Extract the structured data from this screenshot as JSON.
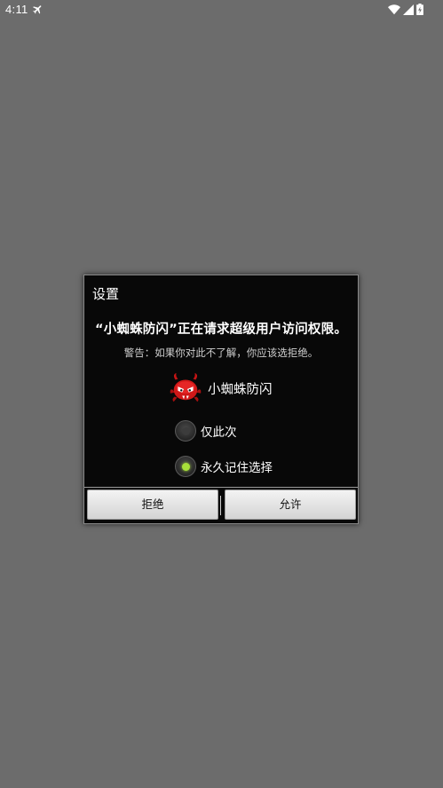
{
  "status_bar": {
    "time": "4:11",
    "icons": [
      "airplane-icon",
      "wifi-icon",
      "signal-icon",
      "battery-icon"
    ]
  },
  "dialog": {
    "title": "设置",
    "heading": "“小蜘蛛防闪”正在请求超级用户访问权限。",
    "warning": "警告：如果你对此不了解，你应该选拒绝。",
    "app_name": "小蜘蛛防闪",
    "options": [
      {
        "label": "仅此次",
        "checked": false
      },
      {
        "label": "永久记住选择",
        "checked": true
      }
    ],
    "buttons": {
      "deny": "拒绝",
      "allow": "允许"
    }
  },
  "colors": {
    "background": "#6c6c6c",
    "dialog_bg": "#080808",
    "radio_checked": "#a8e03a"
  }
}
